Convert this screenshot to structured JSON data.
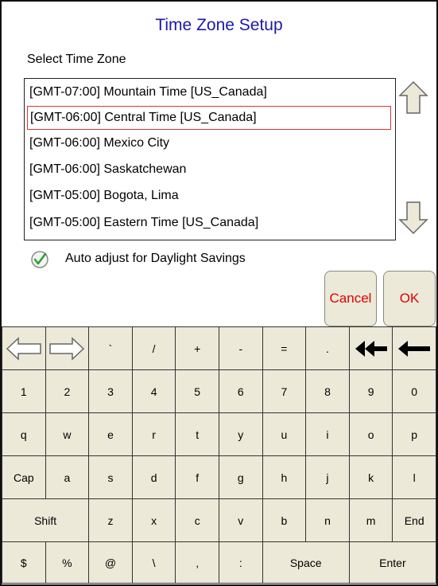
{
  "title": "Time Zone Setup",
  "select_label": "Select Time Zone",
  "timezones": [
    "[GMT-07:00] Mountain Time [US_Canada]",
    "[GMT-06:00] Central Time [US_Canada]",
    "[GMT-06:00] Mexico City",
    "[GMT-06:00] Saskatchewan",
    "[GMT-05:00] Bogota, Lima",
    "[GMT-05:00] Eastern Time [US_Canada]"
  ],
  "selected_index": 1,
  "dst": {
    "label": "Auto adjust for Daylight Savings",
    "checked": true
  },
  "buttons": {
    "cancel": "Cancel",
    "ok": "OK"
  },
  "keyboard": {
    "rows": [
      [
        "left-arrow-icon",
        "right-arrow-icon",
        "`",
        "/",
        "+",
        "-",
        "=",
        ".",
        "double-backspace-icon",
        "backspace-icon"
      ],
      [
        "1",
        "2",
        "3",
        "4",
        "5",
        "6",
        "7",
        "8",
        "9",
        "0"
      ],
      [
        "q",
        "w",
        "e",
        "r",
        "t",
        "y",
        "u",
        "i",
        "o",
        "p"
      ],
      [
        "Cap",
        "a",
        "s",
        "d",
        "f",
        "g",
        "h",
        "j",
        "k",
        "l"
      ],
      [
        "Shift",
        "z",
        "x",
        "c",
        "v",
        "b",
        "n",
        "m",
        "End"
      ],
      [
        "$",
        "%",
        "@",
        "\\",
        ",",
        ":",
        "Space",
        "Enter"
      ]
    ]
  },
  "colors": {
    "title": "#1a1aaa",
    "selection_border": "#d23a3a",
    "button_text": "#e00000",
    "key_bg": "#ece9d8"
  }
}
